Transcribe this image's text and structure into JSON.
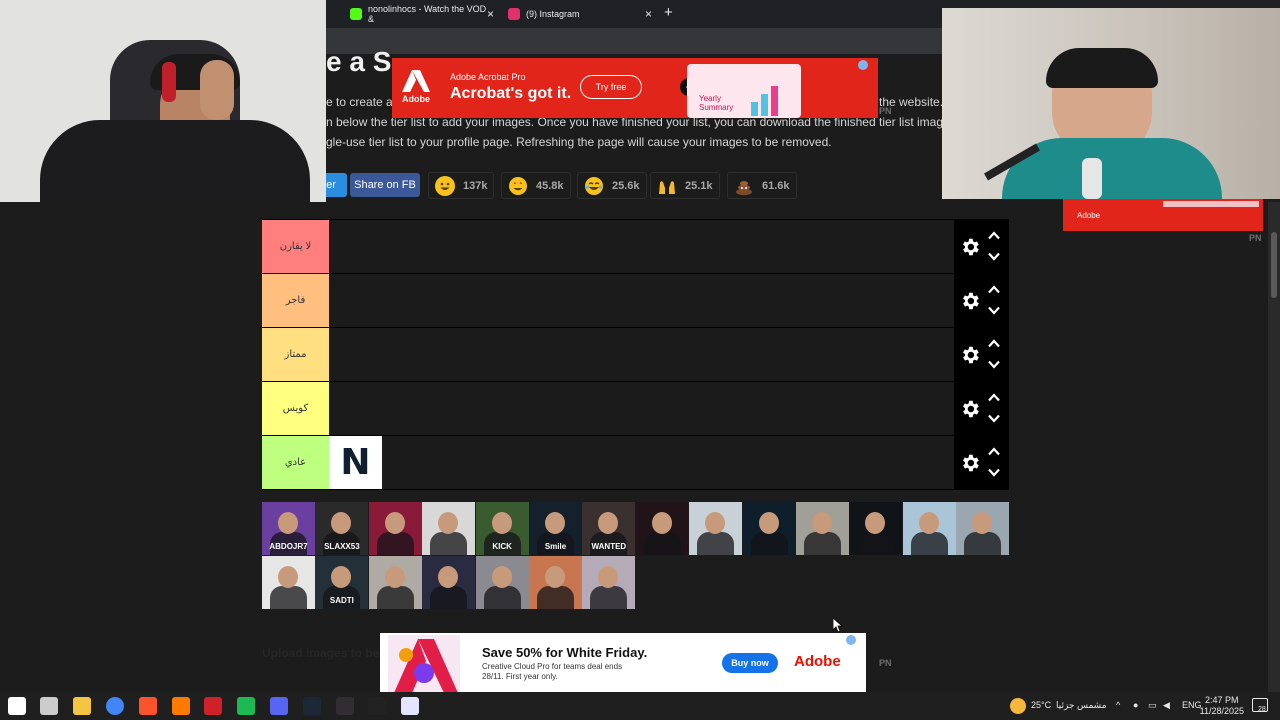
{
  "browser": {
    "tabs": [
      {
        "title": "nonolinhocs - Watch the VOD &",
        "icon_color": "#53fc18"
      },
      {
        "title": "(9) Instagram",
        "icon_color": "#e1306c"
      }
    ],
    "new_tab_glyph": "+",
    "close_glyph": "×"
  },
  "page": {
    "title": "e a S",
    "description_lines": [
      "e to create a s",
      "n below the tier list to add your images. Once you have finished your list, you can download the finished tier list image. It is",
      "gle-use tier list to your profile page. Refreshing the page will cause your images to be removed."
    ],
    "description_tail": "the website.",
    "share": {
      "twitter": "tter",
      "facebook": "Share on FB"
    },
    "reactions": [
      {
        "emoji": "grinning-face",
        "count": "137k",
        "color": "#f7c21d"
      },
      {
        "emoji": "star-struck",
        "count": "45.8k",
        "color": "#f56a3b"
      },
      {
        "emoji": "laughing-tears",
        "count": "25.6k",
        "color": "#f7c21d"
      },
      {
        "emoji": "raised-hands",
        "count": "25.1k",
        "color": "#f2b92c"
      },
      {
        "emoji": "pile-of-poo",
        "count": "61.6k",
        "color": "#7a4a2a"
      }
    ],
    "upload_label": "Upload images to be"
  },
  "tiers": [
    {
      "label": "لا يقارن",
      "color": "#ff7f7f"
    },
    {
      "label": "فاجر",
      "color": "#ffbf7f"
    },
    {
      "label": "ممتاز",
      "color": "#ffdf7f"
    },
    {
      "label": "كويس",
      "color": "#ffff7f"
    },
    {
      "label": "عادي",
      "color": "#bfff7f"
    }
  ],
  "tier_items": {
    "last_tier_logo": "N"
  },
  "pool": [
    {
      "color": "#6a3fa0",
      "text": "ABDOJR7"
    },
    {
      "color": "#2a2a2a",
      "text": "SLAXX53"
    },
    {
      "color": "#8a1a3a",
      "text": ""
    },
    {
      "color": "#d8d8d8",
      "text": ""
    },
    {
      "color": "#3a5a30",
      "text": "KICK"
    },
    {
      "color": "#14202c",
      "text": "Smile"
    },
    {
      "color": "#3a3030",
      "text": "WANTED"
    },
    {
      "color": "#201418",
      "text": ""
    },
    {
      "color": "#c8d0d8",
      "text": ""
    },
    {
      "color": "#0e1e2a",
      "text": ""
    },
    {
      "color": "#a0a098",
      "text": ""
    },
    {
      "color": "#101418",
      "text": ""
    },
    {
      "color": "#aac4d8",
      "text": ""
    },
    {
      "color": "#9aa6b0",
      "text": ""
    },
    {
      "color": "#e6e6e6",
      "text": ""
    },
    {
      "color": "#243038",
      "text": "SADTI"
    },
    {
      "color": "#b0aaa4",
      "text": ""
    },
    {
      "color": "#2a2a40",
      "text": ""
    },
    {
      "color": "#8a8a90",
      "text": ""
    },
    {
      "color": "#c87650",
      "text": ""
    },
    {
      "color": "#b4aab8",
      "text": ""
    }
  ],
  "ads": {
    "top": {
      "logo": "Adobe",
      "brand": "Adobe Acrobat Pro",
      "headline": "Acrobat's got it.",
      "cta": "Try free",
      "image_text": "Yearly\nSummary"
    },
    "bottom": {
      "title": "Save 50% for White Friday.",
      "body": "Creative Cloud Pro for teams deal ends 28/11. First year only.",
      "cta": "Buy now",
      "brand": "Adobe"
    },
    "right": {
      "brand": "Adobe"
    },
    "pn": "PN"
  },
  "taskbar": {
    "weather": "25°C",
    "weather_text": "مشمس جزئيا",
    "lang": "ENG",
    "time": "2:47 PM",
    "date": "11/28/2025",
    "notifications": "28",
    "apps": [
      {
        "name": "windows",
        "color": "#ffffff"
      },
      {
        "name": "task-view",
        "color": "#cccccc"
      },
      {
        "name": "file-explorer",
        "color": "#f4c542"
      },
      {
        "name": "chrome",
        "color": "#4285f4"
      },
      {
        "name": "brave",
        "color": "#fb542b"
      },
      {
        "name": "app-orange",
        "color": "#ff7a00"
      },
      {
        "name": "app-red",
        "color": "#d0202a"
      },
      {
        "name": "spotify",
        "color": "#1db954"
      },
      {
        "name": "discord",
        "color": "#5865f2"
      },
      {
        "name": "steam",
        "color": "#1b2838"
      },
      {
        "name": "obs",
        "color": "#302e31"
      },
      {
        "name": "capcut",
        "color": "#222222"
      },
      {
        "name": "app-ring",
        "color": "#e4e4ff"
      }
    ]
  }
}
